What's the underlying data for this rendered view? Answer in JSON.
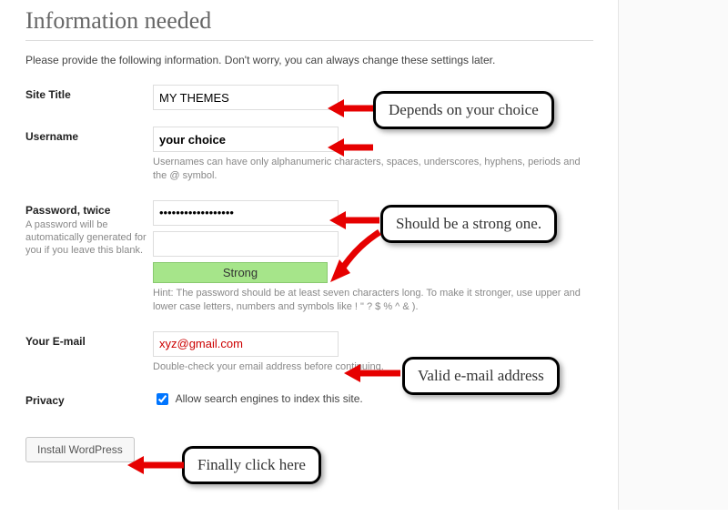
{
  "page": {
    "heading": "Information needed",
    "intro": "Please provide the following information. Don't worry, you can always change these settings later."
  },
  "form": {
    "site_title_label": "Site Title",
    "site_title_value": "MY THEMES",
    "username_label": "Username",
    "username_value": "your choice",
    "username_hint": "Usernames can have only alphanumeric characters, spaces, underscores, hyphens, periods and the @ symbol.",
    "password_label": "Password, twice",
    "password_sublabel": "A password will be automatically generated for you if you leave this blank.",
    "password_value": "••••••••••••••••••",
    "password_confirm_value": "",
    "password_strength": "Strong",
    "password_hint": "Hint: The password should be at least seven characters long. To make it stronger, use upper and lower case letters, numbers and symbols like ! \" ? $ % ^ & ).",
    "email_label": "Your E-mail",
    "email_value": "xyz@gmail.com",
    "email_hint": "Double-check your email address before continuing.",
    "privacy_label": "Privacy",
    "privacy_checkbox_label": "Allow search engines to index this site.",
    "privacy_checked": true,
    "install_button": "Install WordPress"
  },
  "annotations": {
    "site_title": "Depends on your choice",
    "password": "Should be a strong one.",
    "email": "Valid e-mail address",
    "install": "Finally click  here"
  }
}
